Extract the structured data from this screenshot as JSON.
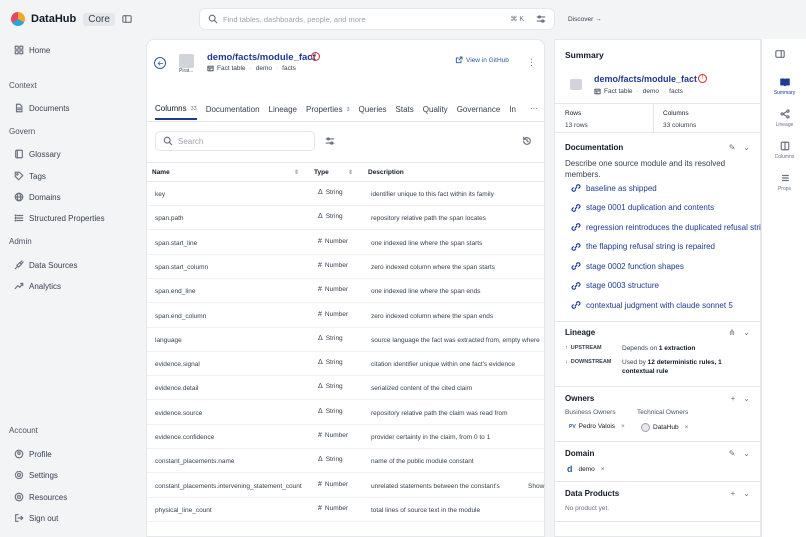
{
  "app": {
    "name": "DataHub",
    "edition": "Core"
  },
  "sidebar": {
    "home": "Home",
    "context_label": "Context",
    "documents": "Documents",
    "govern_label": "Govern",
    "glossary": "Glossary",
    "tags": "Tags",
    "domains": "Domains",
    "structured_properties": "Structured Properties",
    "admin_label": "Admin",
    "data_sources": "Data Sources",
    "analytics": "Analytics",
    "account_label": "Account",
    "profile": "Profile",
    "settings": "Settings",
    "resources": "Resources",
    "sign_out": "Sign out"
  },
  "topbar": {
    "search_placeholder": "Find tables, dashboards, people, and more",
    "shortcut": "⌘ K",
    "discover": "Discover"
  },
  "entity": {
    "platform_label": "Pirat...",
    "title": "demo/facts/module_fact",
    "subtype": "Fact table",
    "crumb1": "demo",
    "crumb2": "facts",
    "github": "View in GitHub"
  },
  "tabs": [
    {
      "label": "Columns",
      "badge": "33"
    },
    {
      "label": "Documentation",
      "badge": ""
    },
    {
      "label": "Lineage",
      "badge": ""
    },
    {
      "label": "Properties",
      "badge": "3"
    },
    {
      "label": "Queries",
      "badge": ""
    },
    {
      "label": "Stats",
      "badge": ""
    },
    {
      "label": "Quality",
      "badge": ""
    },
    {
      "label": "Governance",
      "badge": ""
    },
    {
      "label": "In",
      "badge": ""
    }
  ],
  "columns_search_placeholder": "Search",
  "table": {
    "headers": {
      "name": "Name",
      "type": "Type",
      "description": "Description"
    },
    "rows": [
      {
        "name": "key",
        "type": "String",
        "desc": "identifier unique to this fact within its family"
      },
      {
        "name": "span.path",
        "type": "String",
        "desc": "repository relative path the span locates"
      },
      {
        "name": "span.start_line",
        "type": "Number",
        "desc": "one indexed line where the span starts"
      },
      {
        "name": "span.start_column",
        "type": "Number",
        "desc": "zero indexed column where the span starts"
      },
      {
        "name": "span.end_line",
        "type": "Number",
        "desc": "one indexed line where the span ends"
      },
      {
        "name": "span.end_column",
        "type": "Number",
        "desc": "zero indexed column where the span ends"
      },
      {
        "name": "language",
        "type": "String",
        "desc": "source language the fact was extracted from, empty where"
      },
      {
        "name": "evidence.signal",
        "type": "String",
        "desc": "citation identifier unique within one fact's evidence"
      },
      {
        "name": "evidence.detail",
        "type": "String",
        "desc": "serialized content of the cited claim"
      },
      {
        "name": "evidence.source",
        "type": "String",
        "desc": "repository relative path the claim was read from"
      },
      {
        "name": "evidence.confidence",
        "type": "Number",
        "desc": "provider certainty in the claim, from 0 to 1"
      },
      {
        "name": "constant_placements.name",
        "type": "String",
        "desc": "name of the public module constant"
      },
      {
        "name": "constant_placements.intervening_statement_count",
        "type": "Number",
        "desc": "unrelated statements between the constant's",
        "show": "Show"
      },
      {
        "name": "physical_line_count",
        "type": "Number",
        "desc": "total lines of source text in the module"
      }
    ]
  },
  "summary": {
    "title": "Summary",
    "name": "demo/facts/module_fact",
    "subtype": "Fact table",
    "crumb1": "demo",
    "crumb2": "facts",
    "rows_label": "Rows",
    "rows_value": "13 rows",
    "cols_label": "Columns",
    "cols_value": "33 columns",
    "documentation_label": "Documentation",
    "documentation_text": "Describe one source module and its resolved members.",
    "links": [
      "baseline as shipped",
      "stage 0001 duplication and contents",
      "regression reintroduces the duplicated refusal string",
      "the flapping refusal string is repaired",
      "stage 0002 function shapes",
      "stage 0003 structure",
      "contextual judgment with claude sonnet 5"
    ],
    "lineage_label": "Lineage",
    "upstream": "UPSTREAM",
    "upstream_pre": "Depends on",
    "upstream_bold": "1 extraction",
    "downstream": "DOWNSTREAM",
    "downstream_pre": "Used by",
    "downstream_bold": "12 deterministic rules, 1 contextual rule",
    "owners_label": "Owners",
    "business_owners": "Business Owners",
    "technical_owners": "Technical Owners",
    "owner1_initials": "PV",
    "owner1": "Pedro Valois",
    "owner2": "DataHub",
    "domain_label": "Domain",
    "domain_letter": "d",
    "domain": "demo",
    "data_products_label": "Data Products",
    "data_products_none": "No product yet."
  },
  "rail": {
    "summary": "Summary",
    "lineage": "Lineage",
    "columns": "Columns",
    "props": "Props"
  }
}
